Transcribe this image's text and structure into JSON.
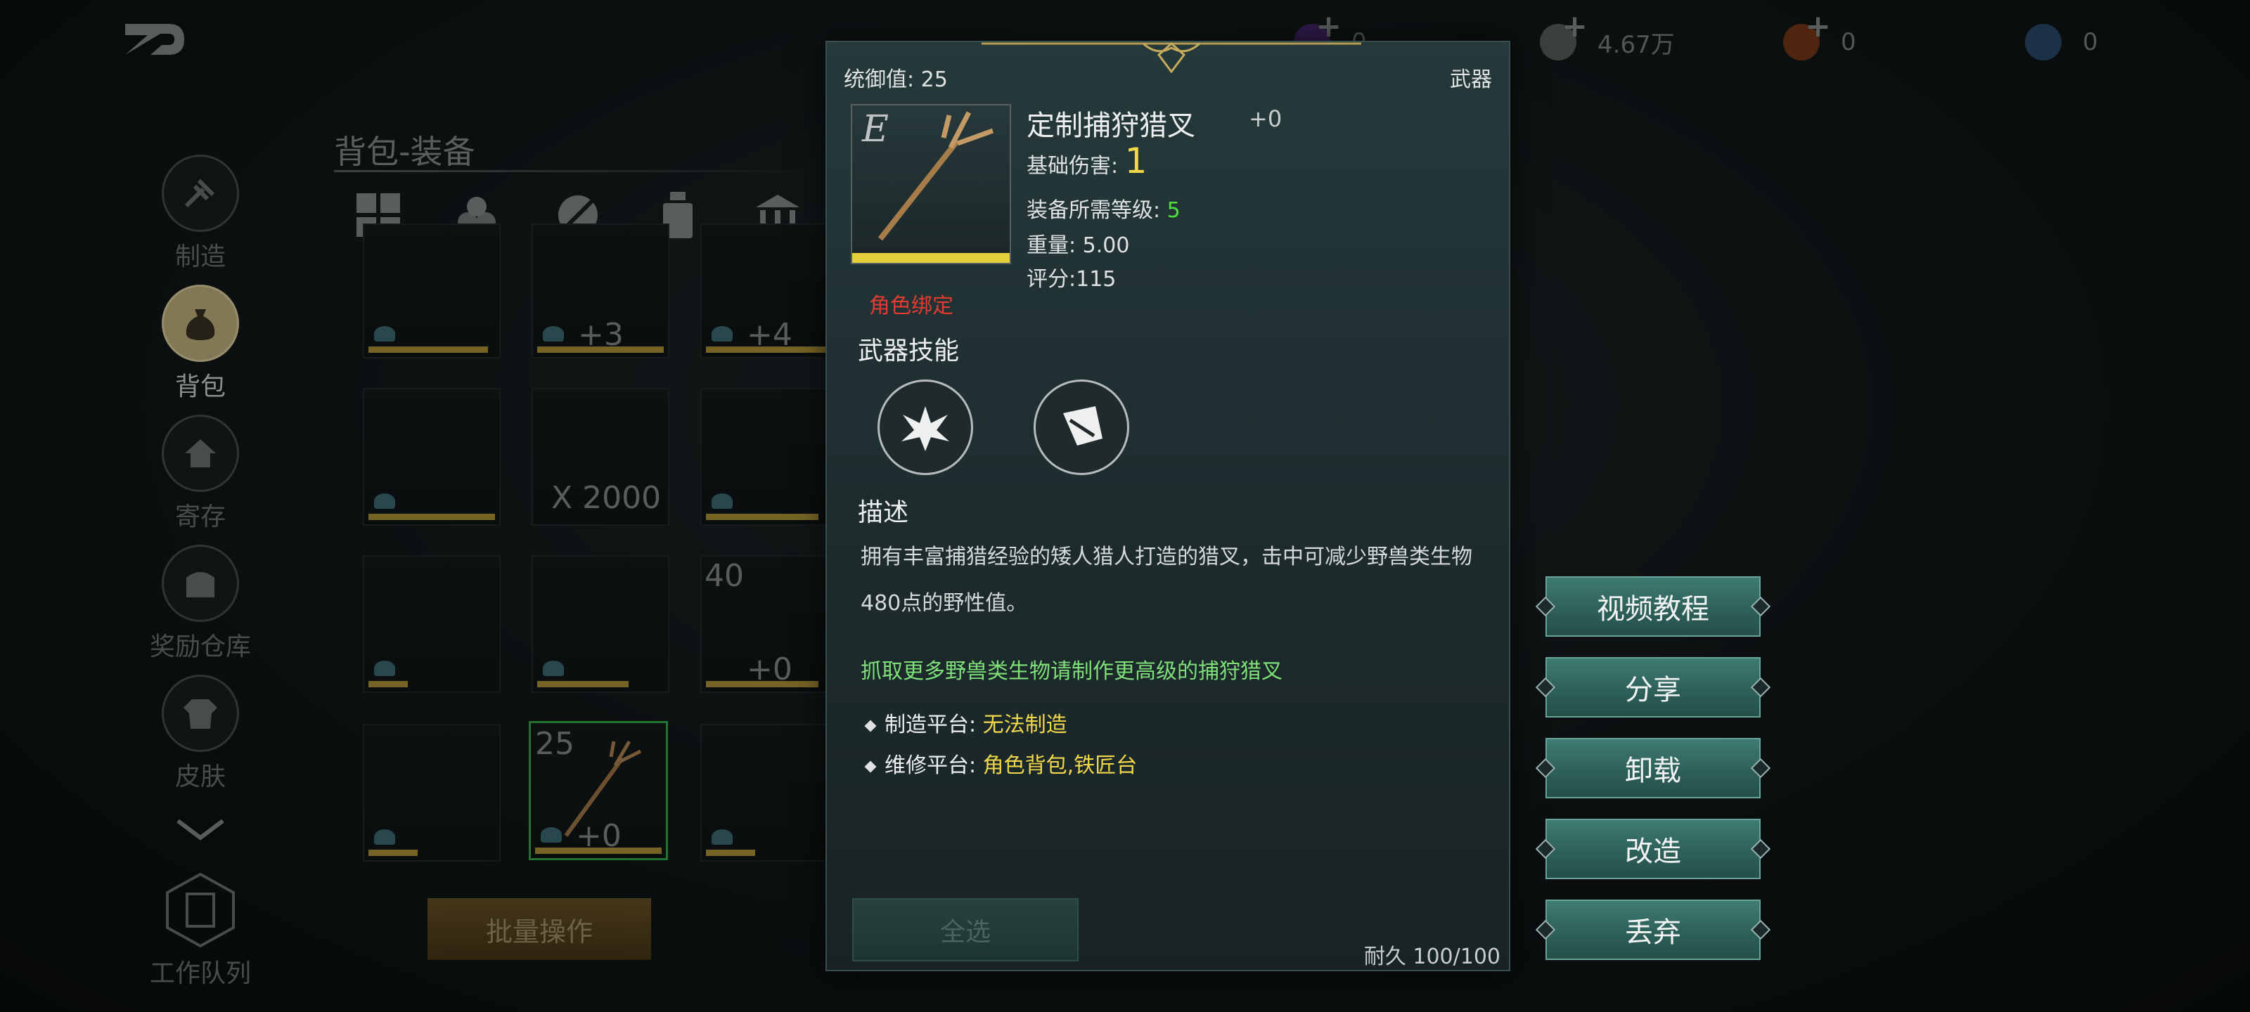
{
  "topbar": {
    "currencies": [
      {
        "icon": "purple-gem-icon",
        "value": "0",
        "color": "#6e3fa8"
      },
      {
        "icon": "silver-coin-icon",
        "value": "4.67万",
        "color": "#7c8384"
      },
      {
        "icon": "orange-token-icon",
        "value": "0",
        "color": "#b5531f"
      },
      {
        "icon": "blue-orb-icon",
        "value": "0",
        "color": "#3c6fa7"
      }
    ]
  },
  "nav": {
    "items": [
      {
        "label": "制造",
        "icon": "hammer-icon"
      },
      {
        "label": "背包",
        "icon": "bag-icon",
        "active": true
      },
      {
        "label": "寄存",
        "icon": "storage-icon"
      },
      {
        "label": "奖励仓库",
        "icon": "reward-chest-icon"
      },
      {
        "label": "皮肤",
        "icon": "armor-icon"
      },
      {
        "label": "工作队列",
        "icon": "work-queue-icon"
      }
    ]
  },
  "bag": {
    "title": "背包-装备",
    "tabs": [
      "all-grid-icon",
      "resources-icon",
      "weapon-tab-icon",
      "potion-icon",
      "building-icon"
    ],
    "slot_texts": [
      "+3",
      "+4",
      "X 2000",
      "40",
      "+0",
      "25",
      "+0"
    ],
    "batch_label": "批量操作"
  },
  "tooltip": {
    "command_label": "统御值:",
    "command_value": "25",
    "type": "武器",
    "icon_letter": "E",
    "bind": "角色绑定",
    "name": "定制捕狩猎叉",
    "refine": "+0",
    "base_damage_label": "基础伤害:",
    "base_damage": "1",
    "req_level_label": "装备所需等级:",
    "req_level": "5",
    "weight_label": "重量:",
    "weight": "5.00",
    "score_label": "评分:",
    "score": "115",
    "skills_title": "武器技能",
    "desc_title": "描述",
    "desc": "拥有丰富捕猎经验的矮人猎人打造的猎叉，击中可减少野兽类生物480点的野性值。",
    "hint": "抓取更多野兽类生物请制作更高级的捕狩猎叉",
    "craft_label": "制造平台:",
    "craft_value": "无法制造",
    "repair_label": "维修平台:",
    "repair_value": "角色背包,铁匠台",
    "durability": "耐久 100/100",
    "select_all": "全选"
  },
  "actions": [
    "视频教程",
    "分享",
    "卸载",
    "改造",
    "丢弃"
  ],
  "colors": {
    "accent_green": "#3e7b73",
    "gold": "#f1d84a",
    "bind_red": "#e23b2f",
    "hint_green": "#7fe07a"
  }
}
